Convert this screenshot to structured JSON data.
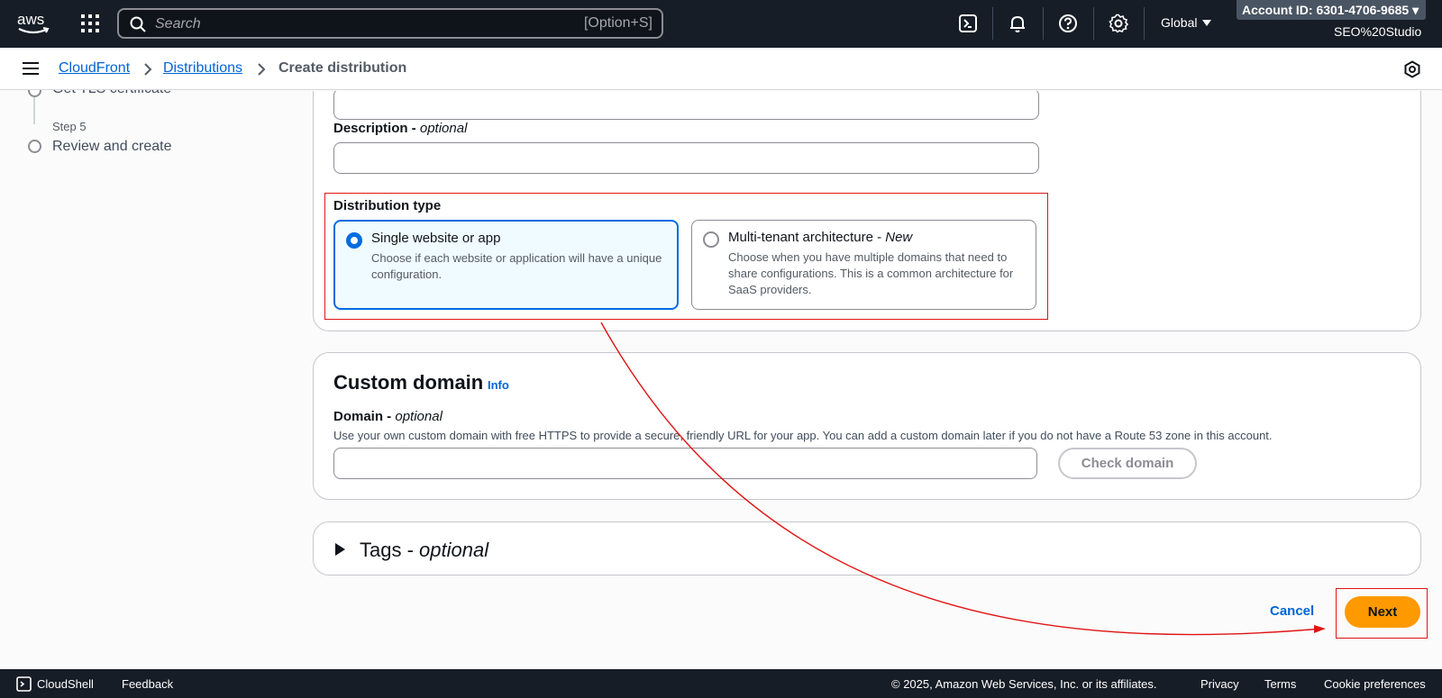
{
  "topnav": {
    "logo": "aws",
    "search_placeholder": "Search",
    "search_shortcut": "[Option+S]",
    "region": "Global",
    "account_id": "Account ID: 6301-4706-9685",
    "account_name": "SEO%20Studio",
    "icons": [
      "grid-icon",
      "search-icon",
      "cloudshell-icon",
      "bell-icon",
      "help-icon",
      "settings-icon"
    ]
  },
  "breadcrumb": {
    "items": [
      "CloudFront",
      "Distributions"
    ],
    "current": "Create distribution"
  },
  "steps": {
    "partial_label": "Get TLS certificate",
    "step5_num": "Step 5",
    "step5_label": "Review and create"
  },
  "form": {
    "description_label": "Description",
    "optional": "optional",
    "description_value": "",
    "distribution_type_label": "Distribution type",
    "options": [
      {
        "title": "Single website or app",
        "desc": "Choose if each website or application will have a unique configuration.",
        "selected": true
      },
      {
        "title": "Multi-tenant architecture",
        "badge": "New",
        "desc": "Choose when you have multiple domains that need to share configurations. This is a common architecture for SaaS providers.",
        "selected": false
      }
    ]
  },
  "custom_domain": {
    "heading": "Custom domain",
    "info": "Info",
    "domain_label": "Domain",
    "optional": "optional",
    "desc": "Use your own custom domain with free HTTPS to provide a secure, friendly URL for your app. You can add a custom domain later if you do not have a Route 53 zone in this account.",
    "domain_value": "",
    "check_button": "Check domain"
  },
  "tags": {
    "label": "Tags",
    "optional": "optional"
  },
  "actions": {
    "cancel": "Cancel",
    "next": "Next"
  },
  "footer": {
    "cloudshell": "CloudShell",
    "feedback": "Feedback",
    "copyright": "© 2025, Amazon Web Services, Inc. or its affiliates.",
    "privacy": "Privacy",
    "terms": "Terms",
    "cookie": "Cookie preferences"
  },
  "colors": {
    "accent": "#006ce0",
    "primary_button": "#ff9900",
    "nav_bg": "#161d26",
    "annotation": "#e01414"
  }
}
